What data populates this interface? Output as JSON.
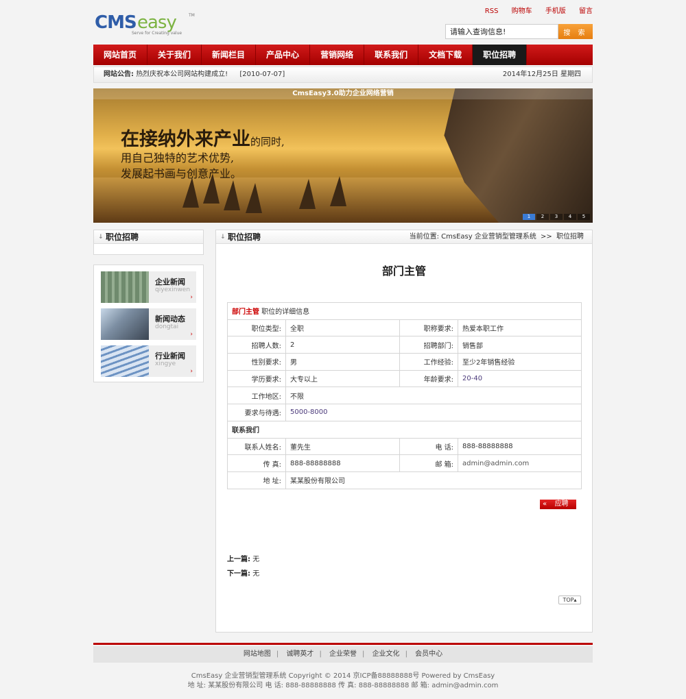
{
  "header": {
    "logo_text": "CMSeasy",
    "logo_tagline": "Serve for Creating value",
    "top_links": [
      "RSS",
      "购物车",
      "手机版",
      "留言"
    ],
    "search_placeholder": "请输入查询信息!",
    "search_button": "搜 索"
  },
  "nav": {
    "items": [
      "网站首页",
      "关于我们",
      "新闻栏目",
      "产品中心",
      "营销网络",
      "联系我们",
      "文档下载",
      "职位招聘"
    ],
    "active_index": 7
  },
  "notice": {
    "label": "网站公告:",
    "text": "热烈庆祝本公司网站构建成立!",
    "date": "[2010-07-07]",
    "today": "2014年12月25日 星期四"
  },
  "banner": {
    "caption": "CmsEasy3.0助力企业网络营销",
    "line1_big": "在接纳外来产业",
    "line1_small": "的同时,",
    "line2": "用自己独特的艺术优势,",
    "line3": "发展起书画与创意产业。",
    "pager": [
      "1",
      "2",
      "3",
      "4",
      "5"
    ],
    "pager_active": 0
  },
  "sidebar": {
    "title": "职位招聘",
    "categories": [
      {
        "title": "企业新闻",
        "sub": "qiyexinwen",
        "icon": "roof-panel-image"
      },
      {
        "title": "新闻动态",
        "sub": "dongtai",
        "icon": "steel-frame-image"
      },
      {
        "title": "行业新闻",
        "sub": "xingye",
        "icon": "louver-image"
      }
    ]
  },
  "main": {
    "title": "职位招聘",
    "breadcrumb_label": "当前位置:",
    "breadcrumb_site": "CmsEasy 企业营销型管理系统",
    "breadcrumb_sep": ">>",
    "breadcrumb_current": "职位招聘",
    "job_title": "部门主管",
    "detail_header_name": "部门主管",
    "detail_header_suffix": "职位的详细信息",
    "rows": [
      {
        "k1": "职位类型:",
        "v1": "全职",
        "k2": "职称要求:",
        "v2": "热爱本职工作"
      },
      {
        "k1": "招聘人数:",
        "v1": "2",
        "k2": "招聘部门:",
        "v2": "销售部"
      },
      {
        "k1": "性别要求:",
        "v1": "男",
        "k2": "工作经验:",
        "v2": "至少2年销售经验"
      },
      {
        "k1": "学历要求:",
        "v1": "大专以上",
        "k2": "年龄要求:",
        "v2": "20-40"
      }
    ],
    "location_label": "工作地区:",
    "location_value": "不限",
    "salary_label": "要求与待遇:",
    "salary_value": "5000-8000",
    "contact_header": "联系我们",
    "contact_rows": [
      {
        "k1": "联系人姓名:",
        "v1": "董先生",
        "k2": "电 话:",
        "v2": "888-88888888"
      },
      {
        "k1": "传 真:",
        "v1": "888-88888888",
        "k2": "邮 箱:",
        "v2": "admin@admin.com"
      }
    ],
    "address_label": "地 址:",
    "address_value": "某某股份有限公司",
    "apply_button": "应聘",
    "prev_label": "上一篇:",
    "prev_value": "无",
    "next_label": "下一篇:",
    "next_value": "无",
    "top_button": "TOP"
  },
  "footer": {
    "links": [
      "网站地图",
      "诚聘英才",
      "企业荣誉",
      "企业文化",
      "会员中心"
    ],
    "copyright": "CmsEasy 企业营销型管理系统  Copyright © 2014  京ICP备88888888号  Powered by CmsEasy",
    "contact": "地 址: 某某股份有限公司  电 话: 888-88888888  传 真: 888-88888888  邮 箱: admin@admin.com"
  },
  "colors": {
    "brand_red": "#b00000",
    "search_orange": "#f08a1c",
    "active_nav": "#1a1a1a"
  }
}
